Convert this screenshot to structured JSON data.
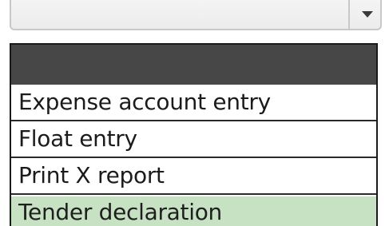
{
  "combo": {
    "value": "",
    "arrow_icon": "chevron-down-icon"
  },
  "dropdown": {
    "header": "",
    "options": [
      {
        "label": "Expense account entry",
        "selected": false
      },
      {
        "label": "Float entry",
        "selected": false
      },
      {
        "label": "Print X report",
        "selected": false
      },
      {
        "label": "Tender declaration",
        "selected": true
      }
    ]
  },
  "colors": {
    "selected_bg": "#c6e2c3",
    "header_bg": "#474747"
  }
}
